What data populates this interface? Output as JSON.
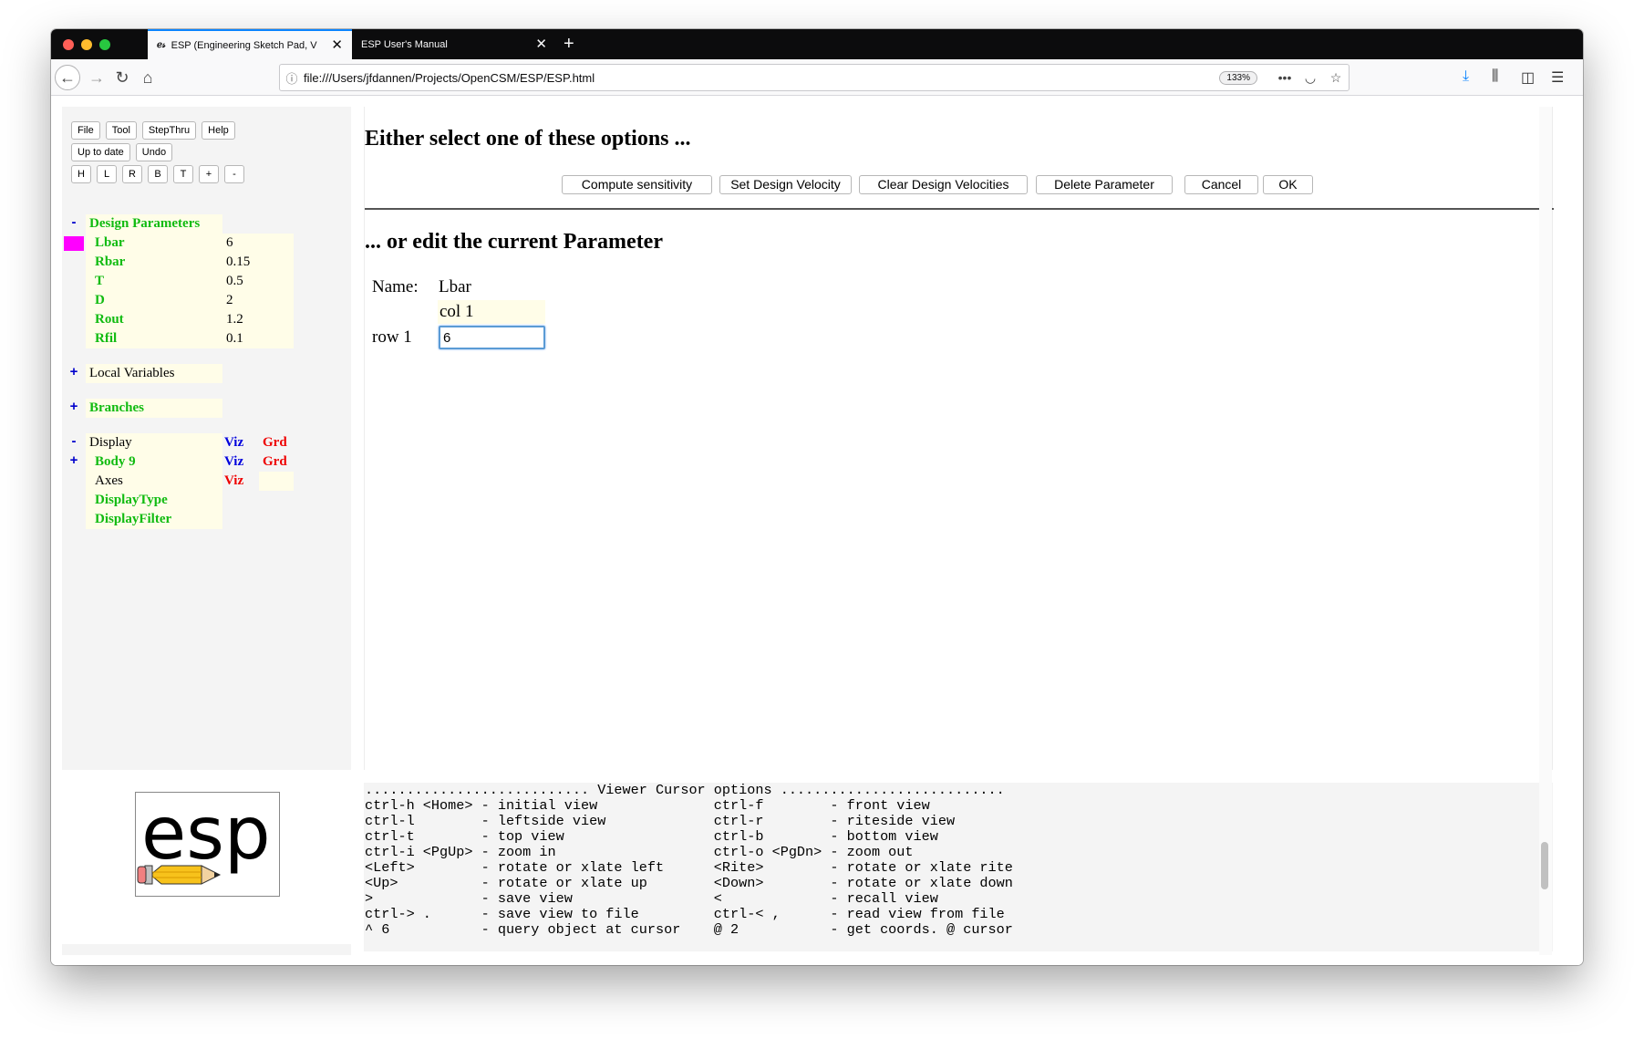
{
  "browser": {
    "tabs": [
      {
        "title": "ESP (Engineering Sketch Pad, V",
        "favicon": "esp"
      },
      {
        "title": "ESP User's Manual"
      }
    ],
    "url": "file:///Users/jfdannen/Projects/OpenCSM/ESP/ESP.html",
    "zoom": "133%"
  },
  "toolbar": {
    "row1": [
      "File",
      "Tool",
      "StepThru",
      "Help"
    ],
    "row2": [
      "Up to date",
      "Undo"
    ],
    "views": [
      "H",
      "L",
      "R",
      "B",
      "T",
      "+",
      "-"
    ]
  },
  "tree": {
    "design_params": {
      "toggle": "-",
      "label": "Design Parameters",
      "items": [
        {
          "name": "Lbar",
          "value": "6"
        },
        {
          "name": "Rbar",
          "value": "0.15"
        },
        {
          "name": "T",
          "value": "0.5"
        },
        {
          "name": "D",
          "value": "2"
        },
        {
          "name": "Rout",
          "value": "1.2"
        },
        {
          "name": "Rfil",
          "value": "0.1"
        }
      ]
    },
    "local_vars": {
      "toggle": "+",
      "label": "Local Variables"
    },
    "branches": {
      "toggle": "+",
      "label": "Branches"
    },
    "display": {
      "toggle": "-",
      "label": "Display",
      "viz": "Viz",
      "grd": "Grd",
      "body": {
        "toggle": "+",
        "label": "Body 9",
        "viz": "Viz",
        "grd": "Grd"
      },
      "axes": {
        "label": "Axes",
        "viz": "Viz"
      },
      "display_type": "DisplayType",
      "display_filter": "DisplayFilter"
    }
  },
  "main": {
    "heading_options": "Either select one of these options ...",
    "buttons": {
      "compute": "Compute sensitivity",
      "set_velocity": "Set Design Velocity",
      "clear_velocities": "Clear Design Velocities",
      "delete": "Delete Parameter",
      "cancel": "Cancel",
      "ok": "OK"
    },
    "heading_edit": "... or edit the current Parameter",
    "param": {
      "name_label": "Name:",
      "name_value": "Lbar",
      "col_header": "col 1",
      "row_label": "row 1",
      "value": "6"
    }
  },
  "messages": [
    "........................... Viewer Cursor options ...........................",
    "ctrl-h <Home> - initial view              ctrl-f        - front view",
    "ctrl-l        - leftside view             ctrl-r        - riteside view",
    "ctrl-t        - top view                  ctrl-b        - bottom view",
    "ctrl-i <PgUp> - zoom in                   ctrl-o <PgDn> - zoom out",
    "<Left>        - rotate or xlate left      <Rite>        - rotate or xlate rite",
    "<Up>          - rotate or xlate up        <Down>        - rotate or xlate down",
    ">             - save view                 <             - recall view",
    "ctrl-> .      - save view to file         ctrl-< ,      - read view from file",
    "^ 6           - query object at cursor    @ 2           - get coords. @ cursor"
  ],
  "colors": {
    "accent": "#0a84ff",
    "tree_green": "#11bb11",
    "selected_marker": "#ff00ff",
    "viz_blue": "#0000dd",
    "grd_red": "#ee0000"
  },
  "logo": {
    "text": "esp"
  }
}
